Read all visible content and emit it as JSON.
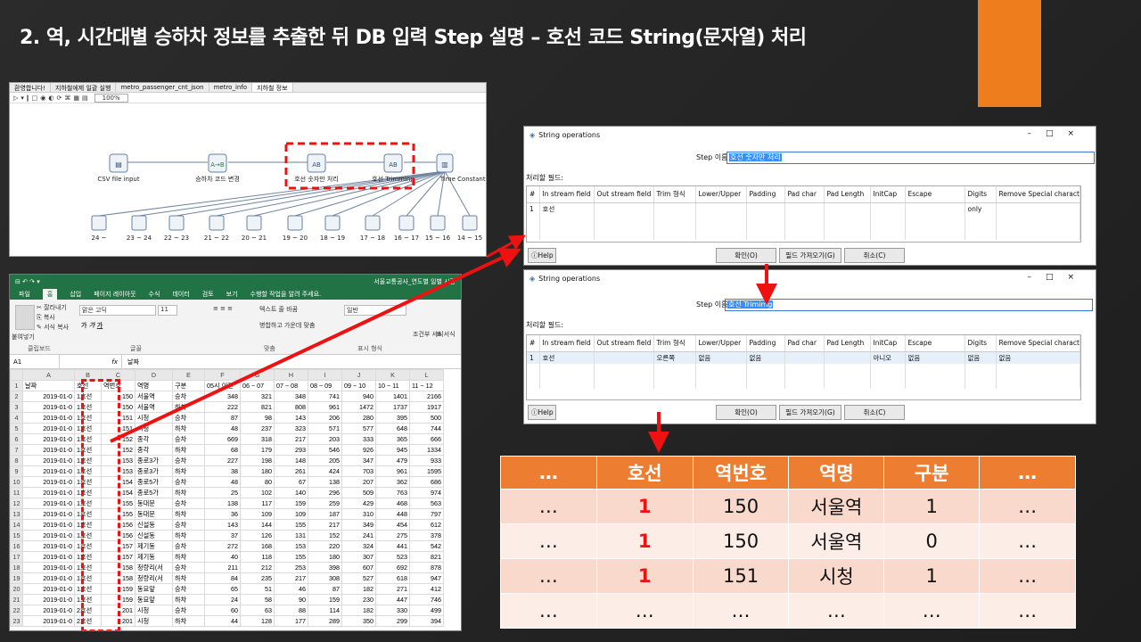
{
  "slide": {
    "title": "2. 역, 시간대별 승하차 정보를 추출한 뒤 DB 입력 Step 설명 – 호선 코드 String(문자열) 처리",
    "accent_color": "#ee7d1d",
    "highlight_color": "#ee1111"
  },
  "pentaho": {
    "tabs": [
      "환영합니다!",
      "지하철에제 일괄 실행",
      "metro_passenger_cnt_json",
      "metro_info",
      "지하철 정보"
    ],
    "zoom": "100%",
    "steps_top": [
      "CSV file input",
      "승하차 코드 변경",
      "호선 숫자만 처리",
      "호선 Trimming",
      "Time Constants"
    ],
    "steps_bottom": [
      "24 ~",
      "23 ~ 24",
      "22 ~ 23",
      "21 ~ 22",
      "20 ~ 21",
      "19 ~ 20",
      "18 ~ 19",
      "17 ~ 18",
      "16 ~ 17",
      "15 ~ 16",
      "14 ~ 15"
    ]
  },
  "excel": {
    "title": "서울교통공사_연도별 일별 시간",
    "menu": [
      "파일",
      "홈",
      "삽입",
      "페이지 레이아웃",
      "수식",
      "데이터",
      "검토",
      "보기",
      "수행할 작업을 알려 주세요."
    ],
    "ribbon": {
      "paste": "붙여넣기",
      "cut": "잘라내기",
      "copy": "복사",
      "format_painter": "서식 복사",
      "font": "맑은 고딕",
      "font_size": "11",
      "wrap": "텍스트 줄 바꿈",
      "merge": "병합하고 가운데 맞춤",
      "number_format": "일반",
      "conditional": "조건부 서식",
      "table_format": "표 서식",
      "groups": [
        "클립보드",
        "글꼴",
        "맞춤",
        "표시 형식"
      ]
    },
    "name_box": "A1",
    "formula_value": "날짜",
    "columns": [
      "A",
      "B",
      "C",
      "D",
      "E",
      "F",
      "G",
      "H",
      "I",
      "J",
      "K",
      "L"
    ],
    "rows": [
      [
        "1",
        "날짜",
        "호선",
        "역번호",
        "역명",
        "구분",
        "05시 이전",
        "06 ~ 07",
        "07 ~ 08",
        "08 ~ 09",
        "09 ~ 10",
        "10 ~ 11",
        "11 ~ 12"
      ],
      [
        "2",
        "2019-01-0",
        "1호선",
        "150",
        "서울역",
        "승차",
        "348",
        "321",
        "348",
        "741",
        "940",
        "1401",
        "2166"
      ],
      [
        "3",
        "2019-01-0",
        "1호선",
        "150",
        "서울역",
        "하차",
        "222",
        "821",
        "808",
        "961",
        "1472",
        "1737",
        "1917"
      ],
      [
        "4",
        "2019-01-0",
        "1호선",
        "151",
        "시청",
        "승차",
        "87",
        "98",
        "143",
        "206",
        "280",
        "395",
        "500"
      ],
      [
        "5",
        "2019-01-0",
        "1호선",
        "151",
        "시청",
        "하차",
        "48",
        "237",
        "323",
        "571",
        "577",
        "648",
        "744"
      ],
      [
        "6",
        "2019-01-0",
        "1호선",
        "152",
        "종각",
        "승차",
        "669",
        "318",
        "217",
        "203",
        "333",
        "365",
        "666"
      ],
      [
        "7",
        "2019-01-0",
        "1호선",
        "152",
        "종각",
        "하차",
        "68",
        "179",
        "293",
        "546",
        "926",
        "945",
        "1334"
      ],
      [
        "8",
        "2019-01-0",
        "1호선",
        "153",
        "종로3가",
        "승차",
        "227",
        "198",
        "148",
        "205",
        "347",
        "479",
        "933"
      ],
      [
        "9",
        "2019-01-0",
        "1호선",
        "153",
        "종로3가",
        "하차",
        "38",
        "180",
        "261",
        "424",
        "703",
        "961",
        "1595"
      ],
      [
        "10",
        "2019-01-0",
        "1호선",
        "154",
        "종로5가",
        "승차",
        "48",
        "80",
        "67",
        "138",
        "207",
        "362",
        "686"
      ],
      [
        "11",
        "2019-01-0",
        "1호선",
        "154",
        "종로5가",
        "하차",
        "25",
        "102",
        "140",
        "296",
        "509",
        "763",
        "974"
      ],
      [
        "12",
        "2019-01-0",
        "1호선",
        "155",
        "동대문",
        "승차",
        "138",
        "117",
        "159",
        "259",
        "429",
        "468",
        "563"
      ],
      [
        "13",
        "2019-01-0",
        "1호선",
        "155",
        "동대문",
        "하차",
        "36",
        "109",
        "109",
        "187",
        "310",
        "448",
        "797"
      ],
      [
        "14",
        "2019-01-0",
        "1호선",
        "156",
        "신설동",
        "승차",
        "143",
        "144",
        "155",
        "217",
        "349",
        "454",
        "612"
      ],
      [
        "15",
        "2019-01-0",
        "1호선",
        "156",
        "신설동",
        "하차",
        "37",
        "126",
        "131",
        "152",
        "241",
        "275",
        "378"
      ],
      [
        "16",
        "2019-01-0",
        "1호선",
        "157",
        "제기동",
        "승차",
        "272",
        "168",
        "153",
        "220",
        "324",
        "441",
        "542"
      ],
      [
        "17",
        "2019-01-0",
        "1호선",
        "157",
        "제기동",
        "하차",
        "40",
        "118",
        "155",
        "180",
        "307",
        "523",
        "821"
      ],
      [
        "18",
        "2019-01-0",
        "1호선",
        "158",
        "청량리(서",
        "승차",
        "211",
        "212",
        "253",
        "398",
        "607",
        "692",
        "878"
      ],
      [
        "19",
        "2019-01-0",
        "1호선",
        "158",
        "청량리(서",
        "하차",
        "84",
        "235",
        "217",
        "308",
        "527",
        "618",
        "947"
      ],
      [
        "20",
        "2019-01-0",
        "1호선",
        "159",
        "동묘앞",
        "승차",
        "65",
        "51",
        "46",
        "87",
        "182",
        "271",
        "412"
      ],
      [
        "21",
        "2019-01-0",
        "1호선",
        "159",
        "동묘앞",
        "하차",
        "24",
        "58",
        "90",
        "159",
        "230",
        "447",
        "746"
      ],
      [
        "22",
        "2019-01-0",
        "2호선",
        "201",
        "시청",
        "승차",
        "60",
        "63",
        "88",
        "114",
        "182",
        "330",
        "499"
      ],
      [
        "23",
        "2019-01-0",
        "2호선",
        "201",
        "시청",
        "하차",
        "44",
        "128",
        "177",
        "289",
        "350",
        "299",
        "394"
      ]
    ]
  },
  "dialog1": {
    "title": "String operations",
    "step_name_label": "Step 이름",
    "step_name_value": "호선 숫자만 처리",
    "fields_label": "처리할 필드:",
    "headers": [
      "#",
      "In stream field",
      "Out stream field",
      "Trim 형식",
      "Lower/Upper",
      "Padding",
      "Pad char",
      "Pad Length",
      "InitCap",
      "Escape",
      "Digits",
      "Remove Special character"
    ],
    "row": [
      "1",
      "호선",
      "",
      "",
      "",
      "",
      "",
      "",
      "",
      "",
      "only",
      ""
    ],
    "help": "Help",
    "ok": "확인(O)",
    "get_fields": "필드 가져오기(G)",
    "cancel": "취소(C)"
  },
  "dialog2": {
    "title": "String operations",
    "step_name_label": "Step 이름",
    "step_name_value": "호선 Trimimg",
    "fields_label": "처리할 필드:",
    "headers": [
      "#",
      "In stream field",
      "Out stream field",
      "Trim 형식",
      "Lower/Upper",
      "Padding",
      "Pad char",
      "Pad Length",
      "InitCap",
      "Escape",
      "Digits",
      "Remove Special character"
    ],
    "row": [
      "1",
      "호선",
      "",
      "오른쪽",
      "없음",
      "없음",
      "",
      "",
      "아니오",
      "없음",
      "없음",
      "없음"
    ],
    "help": "Help",
    "ok": "확인(O)",
    "get_fields": "필드 가져오기(G)",
    "cancel": "취소(C)"
  },
  "result_table": {
    "headers": [
      "…",
      "호선",
      "역번호",
      "역명",
      "구분",
      "…"
    ],
    "rows": [
      [
        "…",
        "1",
        "150",
        "서울역",
        "1",
        "…"
      ],
      [
        "…",
        "1",
        "150",
        "서울역",
        "0",
        "…"
      ],
      [
        "…",
        "1",
        "151",
        "시청",
        "1",
        "…"
      ],
      [
        "…",
        "…",
        "…",
        "…",
        "…",
        "…"
      ]
    ],
    "header_color": "#ed7d31"
  }
}
